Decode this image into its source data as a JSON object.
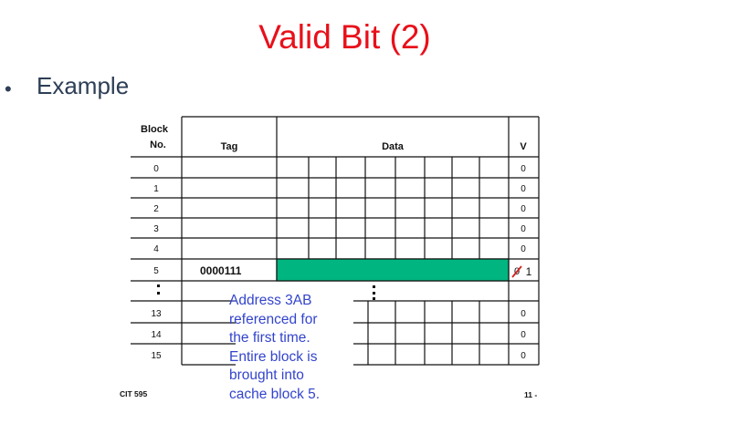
{
  "title": "Valid Bit (2)",
  "bullet": "•",
  "bullet_text": "Example",
  "table": {
    "header_block_line1": "Block",
    "header_block_line2": "No.",
    "header_tag": "Tag",
    "header_data": "Data",
    "header_v": "V",
    "rows": [
      {
        "block": "0",
        "tag": "",
        "v": "0"
      },
      {
        "block": "1",
        "tag": "",
        "v": "0"
      },
      {
        "block": "2",
        "tag": "",
        "v": "0"
      },
      {
        "block": "3",
        "tag": "",
        "v": "0"
      },
      {
        "block": "4",
        "tag": "",
        "v": "0"
      },
      {
        "block": "5",
        "tag": "0000111",
        "v": "1",
        "v_old": "0",
        "filled": true
      },
      {
        "block": "13",
        "tag": "",
        "v": "0"
      },
      {
        "block": "14",
        "tag": "",
        "v": "0"
      },
      {
        "block": "15",
        "tag": "",
        "v": "0"
      }
    ],
    "fill_color": "#00b57f",
    "strike_color": "#d42020"
  },
  "annotation": [
    "Address 3AB",
    "referenced for",
    "the first time.",
    "Entire block is",
    "brought into",
    "cache block 5."
  ],
  "footer_left": "CIT 595",
  "footer_right": "11 -"
}
